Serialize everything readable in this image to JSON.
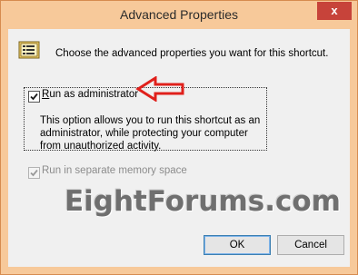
{
  "window": {
    "title": "Advanced Properties",
    "close_glyph": "x"
  },
  "intro": "Choose the advanced properties you want for this shortcut.",
  "options": {
    "run_as_admin": {
      "label_prefix": "R",
      "label_rest": "un as administrator",
      "checked": true,
      "description": "This option allows you to run this shortcut as an administrator, while protecting your computer from unauthorized activity."
    },
    "separate_memory": {
      "label": "Run in separate memory space",
      "checked": true,
      "disabled": true
    }
  },
  "watermark": "EightForums.com",
  "buttons": {
    "ok": "OK",
    "cancel": "Cancel"
  },
  "colors": {
    "frame": "#f7c99a",
    "close": "#c7433a",
    "arrow": "#e0201b",
    "client": "#f0f0f0"
  },
  "icons": [
    "shortcut-properties-icon",
    "close-icon",
    "checkmark-icon",
    "red-arrow-annotation"
  ]
}
